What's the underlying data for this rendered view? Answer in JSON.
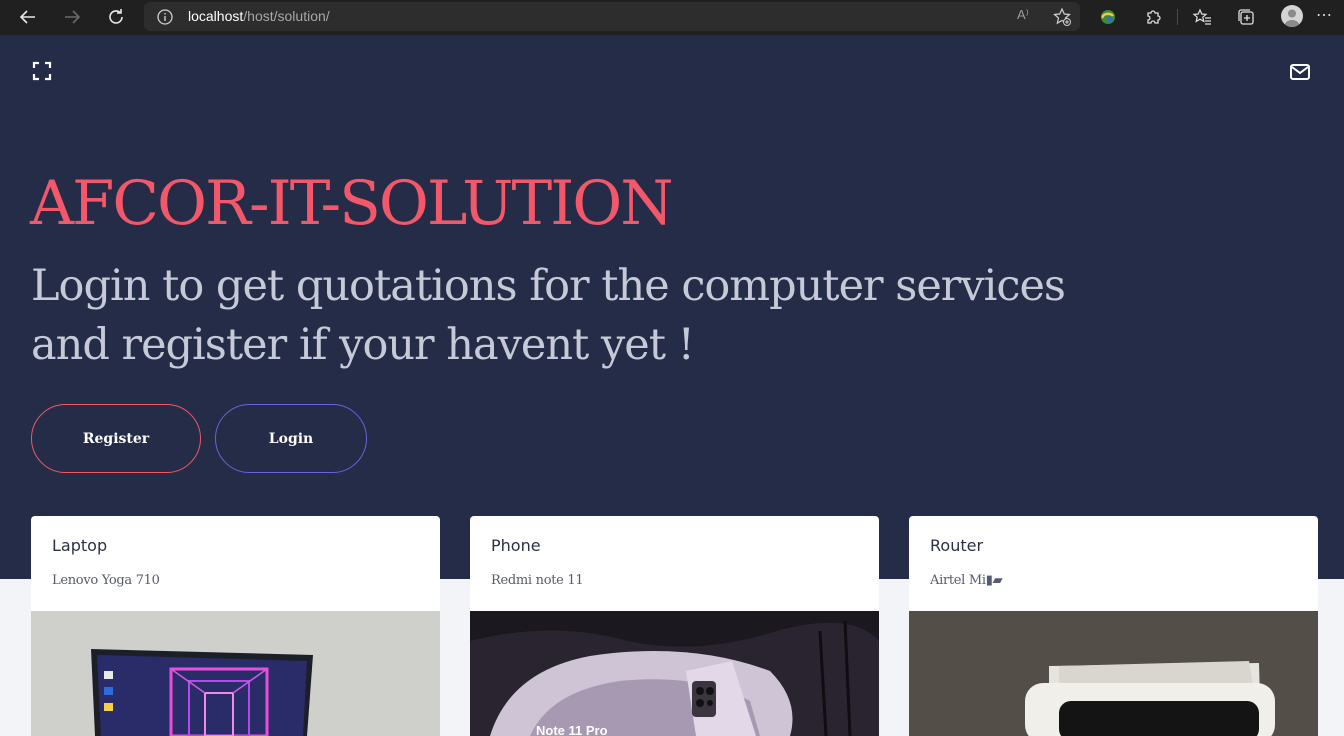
{
  "browser": {
    "url_host": "localhost",
    "url_path": "/host/solution/",
    "read_aloud_label": "A⁾"
  },
  "hero": {
    "brand": "AFCOR-IT-SOLUTION",
    "tagline": "Login to get quotations for the computer services and register if your havent yet !",
    "register_label": "Register",
    "login_label": "Login"
  },
  "cards": [
    {
      "title": "Laptop",
      "subtitle": "Lenovo Yoga 710"
    },
    {
      "title": "Phone",
      "subtitle": "Redmi note 11"
    },
    {
      "title": "Router",
      "subtitle": "Airtel Mi▮▰"
    }
  ],
  "phone_image_caption": "Note 11 Pro",
  "colors": {
    "hero_bg": "#252c47",
    "brand": "#f2576a",
    "register_border": "#f2576a",
    "login_border": "#6a62d9"
  }
}
